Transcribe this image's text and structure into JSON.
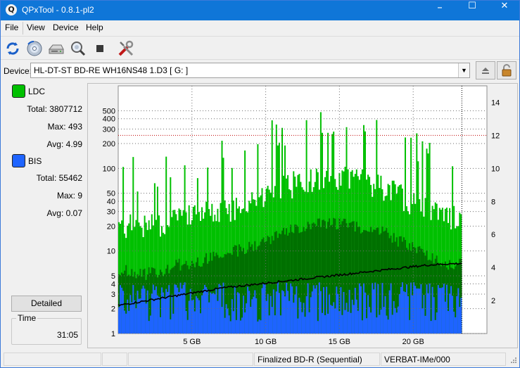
{
  "window": {
    "title": "QPxTool - 0.8.1-pl2",
    "app_icon_glyph": "Q",
    "minimize_glyph": "–",
    "maximize_glyph": "☐",
    "close_glyph": "✕"
  },
  "menu": [
    "File",
    "View",
    "Device",
    "Help"
  ],
  "toolbar": {
    "icons": [
      "refresh-icon",
      "disc-info-icon",
      "drive-icon",
      "scan-search-icon",
      "stop-icon",
      "tools-icon"
    ]
  },
  "device": {
    "label": "Device:",
    "selected": "HL-DT-ST BD-RE  WH16NS48  1.D3 [ G: ]",
    "dropdown_glyph": "▼"
  },
  "ldc": {
    "label": "LDC",
    "color": "#00c000",
    "total_label": "Total:",
    "total_value": "3807712",
    "max_label": "Max:",
    "max_value": "493",
    "avg_label": "Avg:",
    "avg_value": "4.99"
  },
  "bis": {
    "label": "BIS",
    "color": "#1e64ff",
    "total_label": "Total:",
    "total_value": "55462",
    "max_label": "Max:",
    "max_value": "9",
    "avg_label": "Avg:",
    "avg_value": "0.07"
  },
  "detailed_label": "Detailed",
  "time": {
    "label": "Time",
    "value": "31:05"
  },
  "status": {
    "cells": [
      "",
      "",
      "",
      "Finalized BD-R (Sequential)",
      "VERBAT-IMe/000"
    ]
  },
  "chart_data": {
    "type": "area",
    "x_unit": "GB",
    "xlim": [
      0,
      25
    ],
    "x_ticks": [
      5,
      10,
      15,
      20
    ],
    "x_tick_labels": [
      "5 GB",
      "10 GB",
      "15 GB",
      "20 GB"
    ],
    "x_end": 23.3,
    "y_left_scale": "log",
    "y_left_lim": [
      1,
      1000
    ],
    "y_left_ticks": [
      1,
      2,
      3,
      4,
      5,
      10,
      20,
      30,
      40,
      50,
      100,
      200,
      300,
      400,
      500
    ],
    "y_right_lim": [
      0,
      15
    ],
    "y_right_ticks": [
      2,
      4,
      6,
      8,
      10,
      12,
      14
    ],
    "grid": true,
    "right_axis_reference_line": 12,
    "colors": {
      "ldc_bright": "#00c000",
      "ldc_dark": "#007000",
      "bis": "#1e64ff",
      "speed": "#000000",
      "grid": "#6e6e6e",
      "ref_line": "#c00000"
    },
    "series": [
      {
        "name": "LDC",
        "x": [
          0,
          1,
          2,
          3,
          4,
          5,
          6,
          7,
          8,
          9,
          10,
          11,
          12,
          13,
          14,
          15,
          16,
          17,
          18,
          19,
          20,
          21,
          22,
          23.3
        ],
        "values": [
          9,
          8,
          8,
          9,
          10,
          11,
          12,
          13,
          15,
          17,
          20,
          24,
          28,
          30,
          32,
          32,
          30,
          28,
          25,
          20,
          16,
          13,
          11,
          10
        ]
      },
      {
        "name": "BIS",
        "x": [
          0,
          2,
          4,
          6,
          8,
          10,
          12,
          14,
          16,
          18,
          20,
          22,
          23.3
        ],
        "values": [
          2,
          2,
          2,
          2,
          2,
          2,
          2,
          2,
          2,
          2,
          2,
          2,
          2
        ]
      },
      {
        "name": "Speed",
        "axis": "right",
        "x": [
          0,
          1,
          2,
          3,
          4,
          5,
          6,
          7,
          8,
          9,
          10,
          11,
          12,
          13,
          14,
          15,
          16,
          17,
          18,
          19,
          20,
          21,
          22,
          23.3
        ],
        "values": [
          1.7,
          1.85,
          2.0,
          2.15,
          2.3,
          2.45,
          2.6,
          2.75,
          2.85,
          2.95,
          3.05,
          3.15,
          3.25,
          3.35,
          3.45,
          3.55,
          3.65,
          3.75,
          3.85,
          3.95,
          4.05,
          4.15,
          4.2,
          4.25
        ]
      }
    ]
  }
}
